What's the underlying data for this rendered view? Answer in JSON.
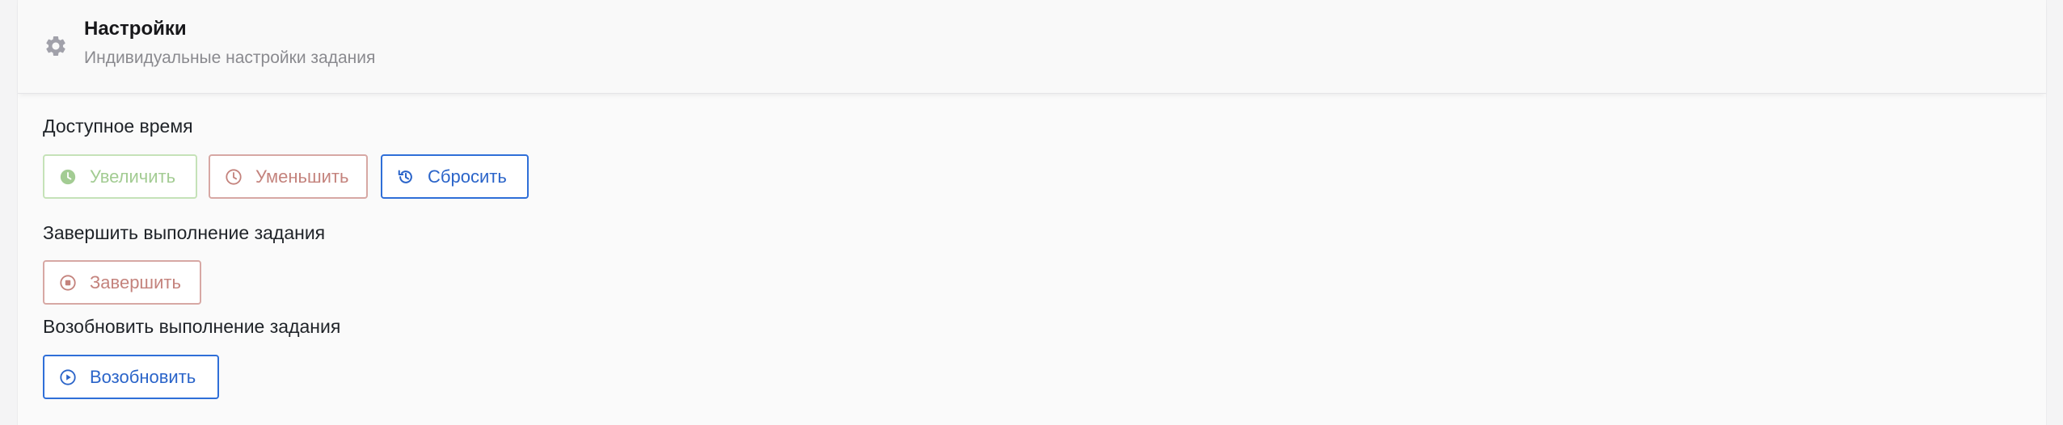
{
  "header": {
    "icon": "gear-icon",
    "title": "Настройки",
    "subtitle": "Индивидуальные настройки задания"
  },
  "time_section": {
    "label": "Доступное время",
    "increase": {
      "label": "Увеличить",
      "icon": "clock-filled-icon",
      "color": "#a3cc93"
    },
    "decrease": {
      "label": "Уменьшить",
      "icon": "clock-outline-icon",
      "color": "#c4837d"
    },
    "reset": {
      "label": "Сбросить",
      "icon": "history-icon",
      "color": "#2a64c9"
    }
  },
  "finish_section": {
    "label": "Завершить выполнение задания",
    "finish": {
      "label": "Завершить",
      "icon": "stop-circle-icon",
      "color": "#c4837d"
    }
  },
  "resume_section": {
    "label": "Возобновить выполнение задания",
    "resume": {
      "label": "Возобновить",
      "icon": "play-circle-icon",
      "color": "#2a64c9"
    }
  }
}
